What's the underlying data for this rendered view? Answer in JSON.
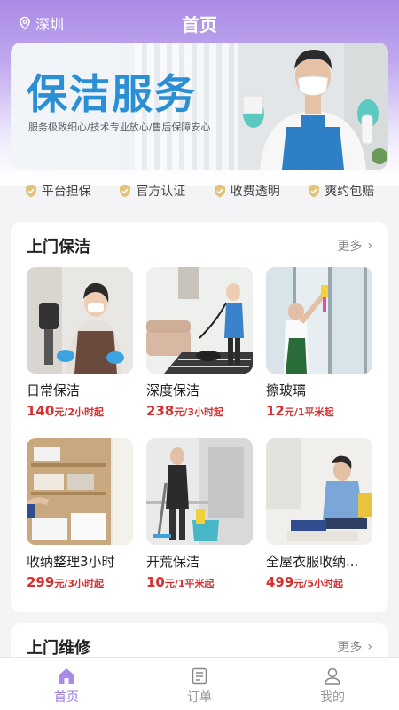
{
  "header": {
    "location": "深圳",
    "title": "首页"
  },
  "banner": {
    "title": "保洁服务",
    "subtitle": "服务极致细心/技术专业放心/售后保障安心"
  },
  "guarantees": [
    {
      "label": "平台担保",
      "icon": "shield-check-icon"
    },
    {
      "label": "官方认证",
      "icon": "shield-check-icon"
    },
    {
      "label": "收费透明",
      "icon": "shield-check-icon"
    },
    {
      "label": "爽约包赔",
      "icon": "shield-check-icon"
    }
  ],
  "section1": {
    "title": "上门保洁",
    "more": "更多",
    "services": [
      {
        "name": "日常保洁",
        "price": "140",
        "unit": "元/2小时起"
      },
      {
        "name": "深度保洁",
        "price": "238",
        "unit": "元/3小时起"
      },
      {
        "name": "擦玻璃",
        "price": "12",
        "unit": "元/1平米起"
      },
      {
        "name": "收纳整理3小时",
        "price": "299",
        "unit": "元/3小时起"
      },
      {
        "name": "开荒保洁",
        "price": "10",
        "unit": "元/1平米起"
      },
      {
        "name": "全屋衣服收纳...",
        "price": "499",
        "unit": "元/5小时起"
      }
    ]
  },
  "section2": {
    "title": "上门维修",
    "more": "更多"
  },
  "tabbar": [
    {
      "label": "首页",
      "icon": "home-icon",
      "active": true
    },
    {
      "label": "订单",
      "icon": "order-list-icon",
      "active": false
    },
    {
      "label": "我的",
      "icon": "user-icon",
      "active": false
    }
  ],
  "colors": {
    "accent": "#9a7be0",
    "price": "#d72f2f",
    "banner_title": "#2b8fd6"
  }
}
